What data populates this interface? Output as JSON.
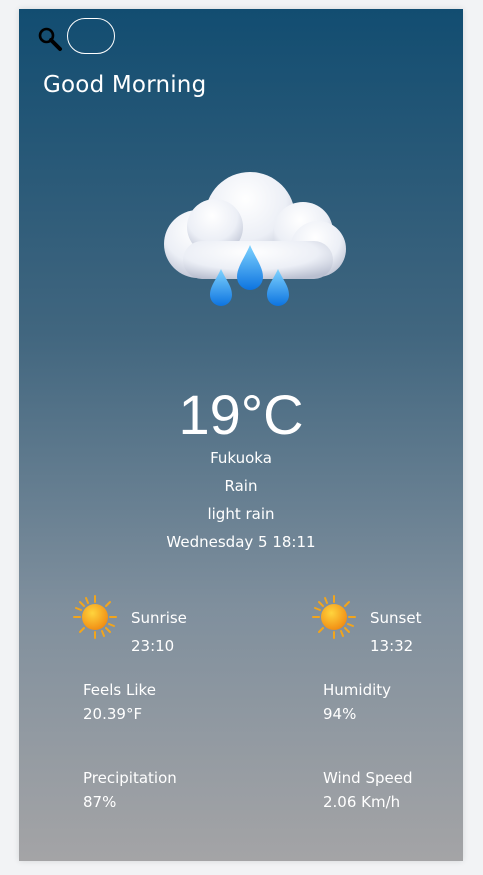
{
  "search": {
    "placeholder": ""
  },
  "greeting": "Good Morning",
  "current": {
    "icon": "rain-cloud-icon",
    "temperature": "19°C",
    "city": "Fukuoka",
    "condition": "Rain",
    "description": "light rain",
    "datetime": "Wednesday 5 18:11"
  },
  "sunrise": {
    "icon": "sun-icon",
    "label": "Sunrise",
    "time": "23:10"
  },
  "sunset": {
    "icon": "sun-icon",
    "label": "Sunset",
    "time": "13:32"
  },
  "details": {
    "feels_like": {
      "label": "Feels Like",
      "value": "20.39°F"
    },
    "humidity": {
      "label": "Humidity",
      "value": "94%"
    },
    "precipitation": {
      "label": "Precipitation",
      "value": "87%"
    },
    "wind_speed": {
      "label": "Wind Speed",
      "value": "2.06 Km/h"
    }
  }
}
